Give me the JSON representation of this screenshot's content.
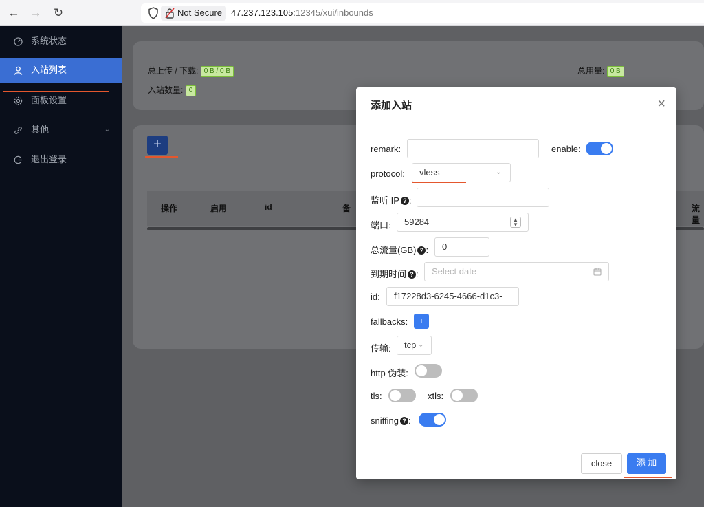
{
  "browser": {
    "not_secure": "Not Secure",
    "url_host": "47.237.123.105",
    "url_rest": ":12345/xui/inbounds"
  },
  "sidebar": {
    "items": [
      {
        "label": "系统状态",
        "icon": "dashboard-icon"
      },
      {
        "label": "入站列表",
        "icon": "user-icon",
        "active": true
      },
      {
        "label": "面板设置",
        "icon": "gear-icon"
      },
      {
        "label": "其他",
        "icon": "link-icon"
      },
      {
        "label": "退出登录",
        "icon": "logout-icon"
      }
    ]
  },
  "stats": {
    "upload_download_label": "总上传 / 下载:",
    "upload_download_value": "0 B / 0 B",
    "total_usage_label": "总用量:",
    "total_usage_value": "0 B",
    "inbound_count_label": "入站数量:",
    "inbound_count_value": "0"
  },
  "table": {
    "add_button": "+",
    "headers": [
      "操作",
      "启用",
      "id",
      "备",
      "流量"
    ]
  },
  "modal": {
    "title": "添加入站",
    "close_icon": "×",
    "fields": {
      "remark_label": "remark:",
      "remark_value": "",
      "enable_label": "enable:",
      "protocol_label": "protocol:",
      "protocol_value": "vless",
      "listen_ip_label": "监听 IP",
      "listen_ip_value": "",
      "port_label": "端口:",
      "port_value": "59284",
      "total_flow_label": "总流量(GB)",
      "total_flow_value": "0",
      "expiry_label": "到期时间",
      "expiry_placeholder": "Select date",
      "id_label": "id:",
      "id_value": "f17228d3-6245-4666-d1c3-",
      "fallbacks_label": "fallbacks:",
      "fallbacks_button": "+",
      "transport_label": "传输:",
      "transport_value": "tcp",
      "http_label": "http 伪装:",
      "tls_label": "tls:",
      "xtls_label": "xtls:",
      "sniffing_label": "sniffing"
    },
    "toggles": {
      "enable": true,
      "http": false,
      "tls": false,
      "xtls": false,
      "sniffing": true
    },
    "footer": {
      "close": "close",
      "add": "添 加"
    },
    "colors": {
      "primary": "#3a7cf0",
      "annotation": "#e4572e"
    }
  }
}
